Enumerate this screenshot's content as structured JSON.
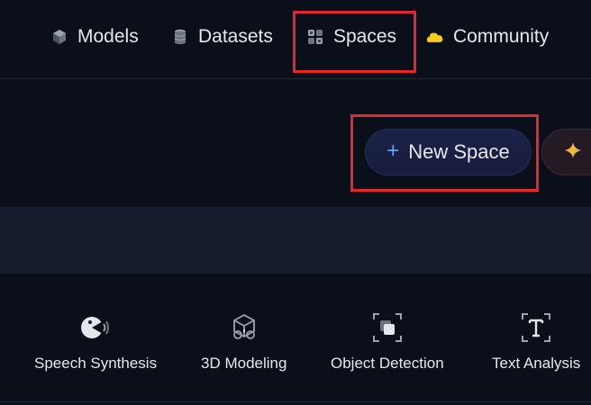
{
  "nav": {
    "items": [
      {
        "label": "Models",
        "icon": "cube-icon"
      },
      {
        "label": "Datasets",
        "icon": "database-icon"
      },
      {
        "label": "Spaces",
        "icon": "grid-icon"
      },
      {
        "label": "Community",
        "icon": "cloud-icon"
      }
    ]
  },
  "actions": {
    "new_space_label": "New Space",
    "plus_glyph": "+"
  },
  "categories": [
    {
      "label": "Speech Synthesis",
      "icon": "speech-icon"
    },
    {
      "label": "3D Modeling",
      "icon": "cube-3d-icon"
    },
    {
      "label": "Object Detection",
      "icon": "object-detection-icon"
    },
    {
      "label": "Text Analysis",
      "icon": "text-analysis-icon"
    }
  ],
  "colors": {
    "background": "#0b0f19",
    "highlight": "#e3262f",
    "accent_blue": "#60a5fa",
    "community_yellow": "#facc15"
  }
}
